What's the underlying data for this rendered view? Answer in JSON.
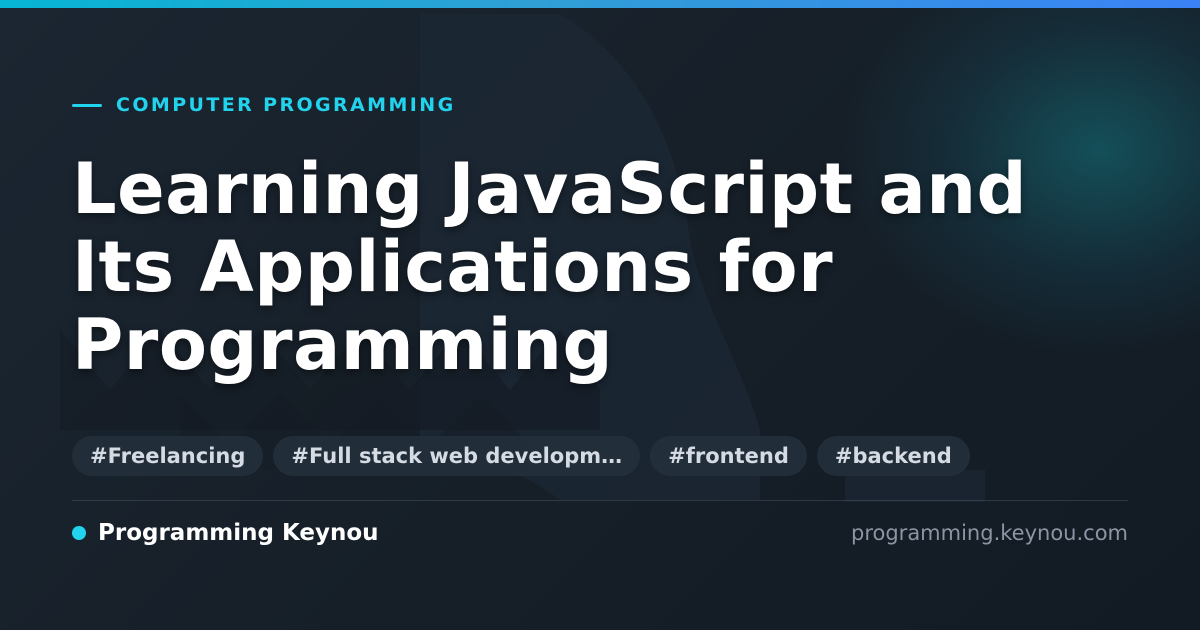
{
  "card": {
    "category": "COMPUTER PROGRAMMING",
    "title": "Learning JavaScript and Its Applications for Programming",
    "tags": [
      "#Freelancing",
      "#Full stack web developm…",
      "#frontend",
      "#backend"
    ],
    "brand": "Programming Keynou",
    "url": "programming.keynou.com"
  },
  "colors": {
    "accent": "#22d3ee",
    "background": "#18212b",
    "top_bar_start": "#06b6d4",
    "top_bar_end": "#3b82f6"
  },
  "icons": {
    "category_marker": "dash-icon",
    "brand_marker": "dot-icon"
  }
}
